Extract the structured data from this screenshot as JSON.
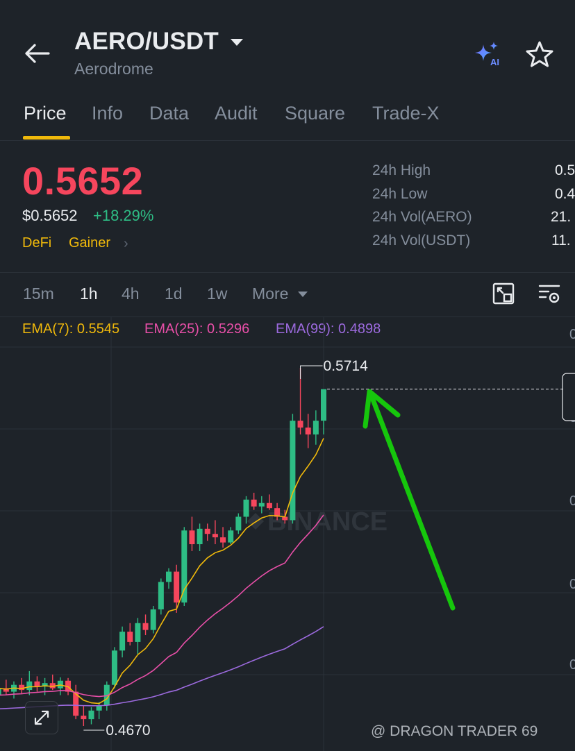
{
  "header": {
    "pair": "AERO/USDT",
    "name": "Aerodrome",
    "icons": [
      "back-arrow-icon",
      "dropdown-caret-icon",
      "ai-sparkle-icon",
      "star-icon"
    ]
  },
  "tabs": [
    {
      "label": "Price",
      "active": true
    },
    {
      "label": "Info"
    },
    {
      "label": "Data"
    },
    {
      "label": "Audit"
    },
    {
      "label": "Square"
    },
    {
      "label": "Trade-X"
    }
  ],
  "price": {
    "last": "0.5652",
    "usd": "$0.5652",
    "change": "+18.29%",
    "tags": [
      "DeFi",
      "Gainer"
    ]
  },
  "stats": [
    {
      "label": "24h High",
      "value": "0.5"
    },
    {
      "label": "24h Low",
      "value": "0.4"
    },
    {
      "label": "24h Vol(AERO)",
      "value": "21."
    },
    {
      "label": "24h Vol(USDT)",
      "value": "11."
    }
  ],
  "intervals": [
    {
      "label": "15m"
    },
    {
      "label": "1h",
      "active": true
    },
    {
      "label": "4h"
    },
    {
      "label": "1d"
    },
    {
      "label": "1w"
    },
    {
      "label": "More"
    }
  ],
  "ema": [
    {
      "text": "EMA(7): 0.5545",
      "color": "#f0b90b"
    },
    {
      "text": "EMA(25): 0.5296",
      "color": "#e84fa8"
    },
    {
      "text": "EMA(99): 0.4898",
      "color": "#9c6ade"
    }
  ],
  "colors": {
    "up": "#2ebd85",
    "down": "#f6465d",
    "accent": "#f0b90b",
    "annotation_arrow": "#16c60c"
  },
  "chart_data": {
    "type": "candlestick",
    "interval": "1h",
    "high_label": "0.5714",
    "low_label": "0.4670",
    "watermark": "BINANCE",
    "ohlc": [
      [
        0.476,
        0.48,
        0.4745,
        0.478
      ],
      [
        0.478,
        0.4805,
        0.476,
        0.477
      ],
      [
        0.477,
        0.48,
        0.475,
        0.479
      ],
      [
        0.479,
        0.481,
        0.4765,
        0.4775
      ],
      [
        0.4775,
        0.483,
        0.476,
        0.48
      ],
      [
        0.48,
        0.4815,
        0.477,
        0.4785
      ],
      [
        0.4785,
        0.481,
        0.476,
        0.4795
      ],
      [
        0.4795,
        0.482,
        0.4775,
        0.478
      ],
      [
        0.478,
        0.4812,
        0.476,
        0.4802
      ],
      [
        0.4802,
        0.481,
        0.476,
        0.477
      ],
      [
        0.477,
        0.479,
        0.469,
        0.47
      ],
      [
        0.47,
        0.473,
        0.467,
        0.469
      ],
      [
        0.469,
        0.4725,
        0.4675,
        0.4715
      ],
      [
        0.4715,
        0.474,
        0.469,
        0.473
      ],
      [
        0.473,
        0.48,
        0.4715,
        0.479
      ],
      [
        0.479,
        0.49,
        0.478,
        0.489
      ],
      [
        0.489,
        0.496,
        0.487,
        0.4945
      ],
      [
        0.4945,
        0.497,
        0.4905,
        0.4915
      ],
      [
        0.4915,
        0.4985,
        0.488,
        0.497
      ],
      [
        0.497,
        0.4995,
        0.4935,
        0.495
      ],
      [
        0.495,
        0.502,
        0.494,
        0.501
      ],
      [
        0.501,
        0.51,
        0.4995,
        0.509
      ],
      [
        0.509,
        0.513,
        0.507,
        0.512
      ],
      [
        0.512,
        0.514,
        0.5,
        0.503
      ],
      [
        0.503,
        0.525,
        0.502,
        0.524
      ],
      [
        0.524,
        0.528,
        0.518,
        0.52
      ],
      [
        0.52,
        0.526,
        0.518,
        0.5245
      ],
      [
        0.5245,
        0.526,
        0.521,
        0.523
      ],
      [
        0.523,
        0.527,
        0.52,
        0.522
      ],
      [
        0.522,
        0.525,
        0.519,
        0.5205
      ],
      [
        0.5205,
        0.525,
        0.52,
        0.524
      ],
      [
        0.524,
        0.529,
        0.523,
        0.528
      ],
      [
        0.528,
        0.534,
        0.526,
        0.533
      ],
      [
        0.533,
        0.535,
        0.53,
        0.531
      ],
      [
        0.531,
        0.534,
        0.529,
        0.532
      ],
      [
        0.532,
        0.5345,
        0.53,
        0.5305
      ],
      [
        0.5305,
        0.532,
        0.527,
        0.528
      ],
      [
        0.528,
        0.53,
        0.526,
        0.527
      ],
      [
        0.527,
        0.558,
        0.526,
        0.556
      ],
      [
        0.556,
        0.5714,
        0.552,
        0.554
      ],
      [
        0.554,
        0.558,
        0.548,
        0.552
      ],
      [
        0.552,
        0.559,
        0.549,
        0.556
      ],
      [
        0.556,
        0.56,
        0.552,
        0.5652
      ]
    ]
  },
  "footer": {
    "watermark": "@ DRAGON TRADER 69"
  }
}
